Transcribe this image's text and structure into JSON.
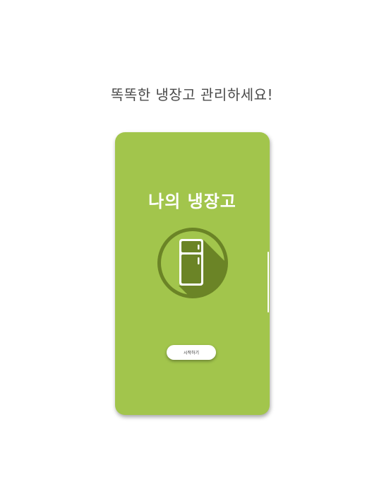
{
  "headline": "똑똑한 냉장고 관리하세요!",
  "app": {
    "title": "나의 냉장고",
    "start_button_label": "시작하기",
    "icon": "refrigerator-icon"
  },
  "colors": {
    "background": "#a2c54c",
    "icon_circle": "#6b8426",
    "icon_shadow": "#5f7a1f",
    "button": "#ffffff",
    "title": "#ffffff"
  }
}
